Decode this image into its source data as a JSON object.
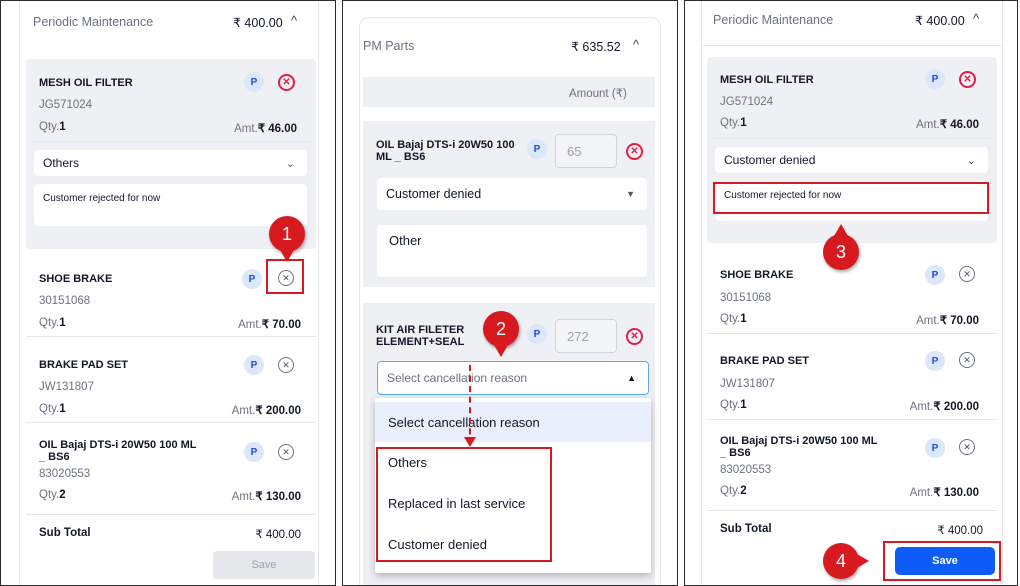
{
  "panel1": {
    "header": {
      "title": "Periodic Maintenance",
      "amount": "₹ 400.00",
      "chevron": "chevron-up-icon"
    },
    "items": [
      {
        "name": "MESH OIL FILTER",
        "code": "JG571024",
        "qty_label": "Qty.",
        "qty": "1",
        "amt_label": "Amt.",
        "amt": "₹ 46.00",
        "badge": "P",
        "reason": "Others",
        "comment": "Customer rejected for now"
      },
      {
        "name": "SHOE BRAKE",
        "code": "30151068",
        "qty_label": "Qty.",
        "qty": "1",
        "amt_label": "Amt.",
        "amt": "₹ 70.00",
        "badge": "P"
      },
      {
        "name": "BRAKE PAD SET",
        "code": "JW131807",
        "qty_label": "Qty.",
        "qty": "1",
        "amt_label": "Amt.",
        "amt": "₹ 200.00",
        "badge": "P"
      },
      {
        "name": "OIL Bajaj DTS-i 20W50 100 ML _ BS6",
        "code": "83020553",
        "qty_label": "Qty.",
        "qty": "2",
        "amt_label": "Amt.",
        "amt": "₹ 130.00",
        "badge": "P"
      }
    ],
    "subtotal_label": "Sub Total",
    "subtotal": "₹ 400.00",
    "save_label": "Save",
    "callout": "1"
  },
  "panel2": {
    "header": {
      "title": "PM Parts",
      "amount": "₹ 635.52",
      "chevron": "chevron-up-icon"
    },
    "amount_col": "Amount (₹)",
    "items": [
      {
        "name": "OIL Bajaj DTS-i 20W50 100 ML _ BS6",
        "badge": "P",
        "qty": "65",
        "reason": "Customer denied",
        "comment": "Other"
      },
      {
        "name": "KIT AIR FILETER ELEMENT+SEAL",
        "badge": "P",
        "qty": "272",
        "placeholder": "Select cancellation reason"
      }
    ],
    "dropdown": {
      "options": [
        "Select cancellation reason",
        "Others",
        "Replaced in last service",
        "Customer denied"
      ]
    },
    "callout": "2"
  },
  "panel3": {
    "header": {
      "title": "Periodic Maintenance",
      "amount": "₹ 400.00",
      "chevron": "chevron-up-icon"
    },
    "items": [
      {
        "name": "MESH OIL FILTER",
        "code": "JG571024",
        "qty_label": "Qty.",
        "qty": "1",
        "amt_label": "Amt.",
        "amt": "₹ 46.00",
        "badge": "P",
        "reason": "Customer denied",
        "comment": "Customer rejected for now"
      },
      {
        "name": "SHOE BRAKE",
        "code": "30151068",
        "qty_label": "Qty.",
        "qty": "1",
        "amt_label": "Amt.",
        "amt": "₹ 70.00",
        "badge": "P"
      },
      {
        "name": "BRAKE PAD SET",
        "code": "JW131807",
        "qty_label": "Qty.",
        "qty": "1",
        "amt_label": "Amt.",
        "amt": "₹ 200.00",
        "badge": "P"
      },
      {
        "name": "OIL Bajaj DTS-i 20W50 100 ML _ BS6",
        "code": "83020553",
        "qty_label": "Qty.",
        "qty": "2",
        "amt_label": "Amt.",
        "amt": "₹ 130.00",
        "badge": "P"
      }
    ],
    "subtotal_label": "Sub Total",
    "subtotal": "₹ 400.00",
    "save_label": "Save",
    "callout3": "3",
    "callout4": "4"
  },
  "colors": {
    "accent_blue": "#0d5cf7",
    "callout_red": "#d71920",
    "remove_red": "#e11d48",
    "card_grey": "#eef0f4"
  }
}
